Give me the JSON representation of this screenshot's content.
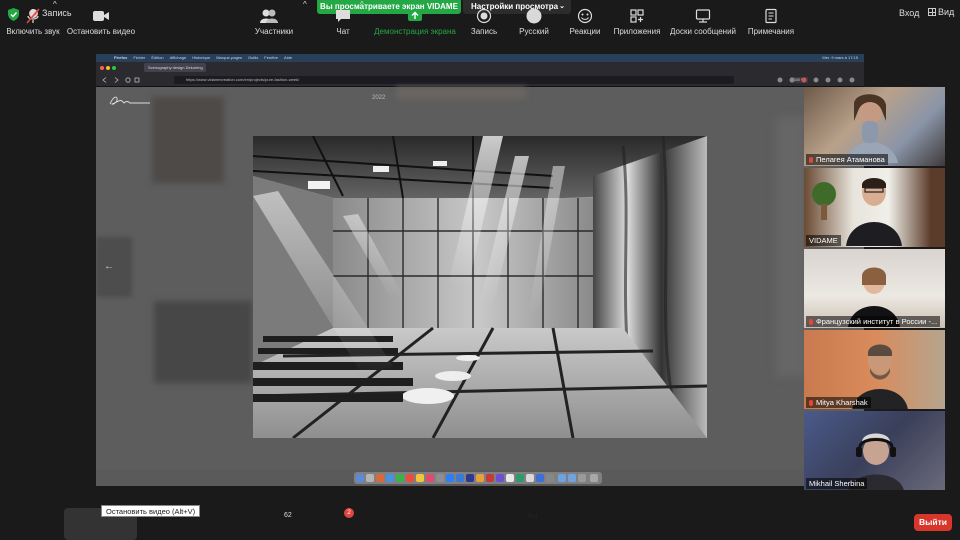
{
  "topbar": {
    "recording_label": "Запись",
    "sharing_banner": "Вы просматриваете экран VIDAME",
    "view_options": "Настройки просмотра",
    "enter_label": "Вход",
    "view_label": "Вид"
  },
  "shared_screen": {
    "mac_menu": [
      "Firefox",
      "Fichier",
      "Édition",
      "Affichage",
      "Historique",
      "Marque-pages",
      "Outils",
      "Fenêtre",
      "Aide"
    ],
    "mac_clock": "Mer. 9 mars à 17:15",
    "tab_title": "Scenography design Dekorimg",
    "url": "https://www.vidamecreation.com/en/projects/pure-fashion-week/",
    "zoom": "100 %",
    "year": "2022",
    "logo": "Vidame"
  },
  "participants": [
    {
      "name": "Пелагея Атаманова",
      "muted": true,
      "active": false
    },
    {
      "name": "VIDAME",
      "muted": false,
      "active": true
    },
    {
      "name": "Французский институт в России -...",
      "muted": true,
      "active": false
    },
    {
      "name": "Mitya Kharshak",
      "muted": true,
      "active": false
    },
    {
      "name": "Mikhail Sherbina",
      "muted": false,
      "active": false
    }
  ],
  "toolbar": {
    "unmute": "Включить звук",
    "stop_video": "Остановить видео",
    "stop_video_tooltip": "Остановить видео (Alt+V)",
    "participants": "Участники",
    "participants_count": "62",
    "chat": "Чат",
    "chat_badge": "2",
    "share_screen": "Демонстрация экрана",
    "record": "Запись",
    "language": "Русский",
    "language_code": "RU",
    "reactions": "Реакции",
    "apps": "Приложения",
    "whiteboards": "Доски сообщений",
    "notes": "Примечания",
    "leave": "Выйти"
  },
  "colors": {
    "share_green": "#23a845",
    "leave_red": "#d8352b",
    "active_speaker": "#c9c24a"
  }
}
